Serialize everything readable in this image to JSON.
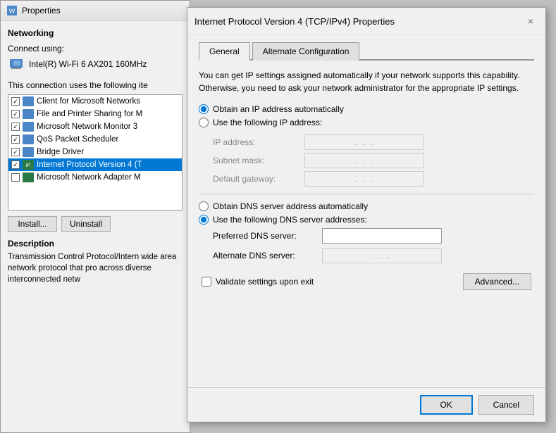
{
  "bg_window": {
    "title": "Properties",
    "networking_label": "Networking",
    "connect_using_label": "Connect using:",
    "adapter_name": "Intel(R) Wi-Fi 6 AX201 160MHz",
    "connection_uses_label": "This connection uses the following ite",
    "components": [
      {
        "checked": true,
        "label": "Client for Microsoft Networks"
      },
      {
        "checked": true,
        "label": "File and Printer Sharing for M"
      },
      {
        "checked": true,
        "label": "Microsoft Network Monitor 3"
      },
      {
        "checked": true,
        "label": "QoS Packet Scheduler"
      },
      {
        "checked": true,
        "label": "Bridge Driver"
      },
      {
        "checked": true,
        "label": "Internet Protocol Version 4 (T",
        "selected": true
      },
      {
        "checked": false,
        "label": "Microsoft Network Adapter M"
      }
    ],
    "install_btn": "Install...",
    "uninstall_btn": "Uninstall",
    "description_label": "Description",
    "description_text": "Transmission Control Protocol/Intern wide area network protocol that pro across diverse interconnected netw"
  },
  "dialog": {
    "title": "Internet Protocol Version 4 (TCP/IPv4) Properties",
    "close_label": "×",
    "tabs": [
      {
        "label": "General",
        "active": true
      },
      {
        "label": "Alternate Configuration",
        "active": false
      }
    ],
    "info_text": "You can get IP settings assigned automatically if your network supports this capability. Otherwise, you need to ask your network administrator for the appropriate IP settings.",
    "obtain_ip_label": "Obtain an IP address automatically",
    "use_ip_label": "Use the following IP address:",
    "ip_fields": [
      {
        "label": "IP address:",
        "value": ". . .",
        "enabled": false
      },
      {
        "label": "Subnet mask:",
        "value": ". . .",
        "enabled": false
      },
      {
        "label": "Default gateway:",
        "value": ". . .",
        "enabled": false
      }
    ],
    "obtain_dns_label": "Obtain DNS server address automatically",
    "use_dns_label": "Use the following DNS server addresses:",
    "dns_fields": [
      {
        "label": "Preferred DNS server:",
        "value": "",
        "enabled": true
      },
      {
        "label": "Alternate DNS server:",
        "value": ". . .",
        "enabled": false
      }
    ],
    "validate_label": "Validate settings upon exit",
    "advanced_btn": "Advanced...",
    "ok_btn": "OK",
    "cancel_btn": "Cancel",
    "obtain_ip_selected": true,
    "use_ip_selected": false,
    "obtain_dns_selected": false,
    "use_dns_selected": true
  }
}
